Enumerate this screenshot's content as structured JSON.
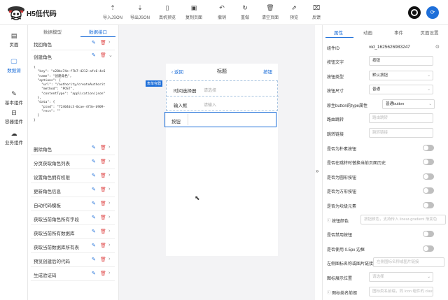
{
  "app": {
    "name": "H5低代码"
  },
  "toolbar": [
    {
      "name": "import-json-button",
      "icon": "import-icon",
      "glyph": "⇡",
      "label": "导入JSON"
    },
    {
      "name": "export-json-button",
      "icon": "export-icon",
      "glyph": "⇣",
      "label": "导出JSON"
    },
    {
      "name": "phone-preview-button",
      "icon": "phone-icon",
      "glyph": "▯",
      "label": "真机预览"
    },
    {
      "name": "copy-page-button",
      "icon": "copy-icon",
      "glyph": "▣",
      "label": "复制页面"
    },
    {
      "name": "undo-button",
      "icon": "undo-icon",
      "glyph": "↶",
      "label": "撤销"
    },
    {
      "name": "redo-button",
      "icon": "redo-icon",
      "glyph": "↻",
      "label": "重做"
    },
    {
      "name": "clear-page-button",
      "icon": "trash-icon",
      "glyph": "🗑",
      "label": "清空页面"
    },
    {
      "name": "preview-button",
      "icon": "preview-icon",
      "glyph": "⇗",
      "label": "预览"
    },
    {
      "name": "feedback-button",
      "icon": "feedback-icon",
      "glyph": "⌧",
      "label": "反馈"
    }
  ],
  "leftnav": [
    {
      "name": "nav-page",
      "icon": "page-icon",
      "glyph": "▤",
      "label": "页面"
    },
    {
      "name": "nav-data-source",
      "icon": "monitor-icon",
      "glyph": "🖵",
      "label": "数据源",
      "active": true
    },
    {
      "name": "nav-basic-components",
      "icon": "edit-icon",
      "glyph": "✎",
      "label": "基本组件"
    },
    {
      "name": "nav-container-components",
      "icon": "box-icon",
      "glyph": "⊟",
      "label": "容器组件"
    },
    {
      "name": "nav-business-components",
      "icon": "cloud-icon",
      "glyph": "☁",
      "label": "业务组件"
    }
  ],
  "datapanel": {
    "tabs": [
      "数据模型",
      "数据接口"
    ],
    "items": [
      "找回角色",
      "创建角色",
      "删除角色",
      "分页获取角色列表",
      "设置角色拥有权限",
      "更新角色信息",
      "自动代码模板",
      "获取当前角色所有字段",
      "获取当前所有数据库",
      "获取当前数据库所有表",
      "预览创建后的代码",
      "生成验证码"
    ],
    "code": "{\n  \"key\": \"e28bc74e-f7b7-4212-afc6-4c6\n  \"name\": \"创建角色\",\n  \"options\": {\n    \"url\": \"/authority/createAuthorit\n    \"method\": \"POST\",\n    \"contentType\": \"application/json\"\n  },\n  \"data\": {\n    \"pind\": \"72404dc3-0cae-4f3e-b909-\n    \"recv\": \"\"\n  }\n}"
  },
  "phone": {
    "back": "返回",
    "title": "标题",
    "button": "按钮",
    "badge": "表单容器",
    "fields": [
      {
        "label": "时间选择器",
        "placeholder": "请选择"
      },
      {
        "label": "输入框",
        "placeholder": "请输入"
      }
    ],
    "selected": "按钮"
  },
  "props": {
    "tabs": [
      "属性",
      "动画",
      "事件",
      "页面设置"
    ],
    "component_id_label": "组件ID",
    "component_id_value": "vid_1625626983247",
    "rows": [
      {
        "label": "按钮文字",
        "type": "input",
        "value": "按钮"
      },
      {
        "label": "按钮类型",
        "type": "select",
        "value": "默认按钮"
      },
      {
        "label": "按钮尺寸",
        "type": "select",
        "value": "普通"
      },
      {
        "label": "原生button的type属性",
        "type": "select",
        "value": "普通button"
      },
      {
        "label": "路由跳转",
        "type": "input",
        "placeholder": "路由跳转"
      },
      {
        "label": "跳转链接",
        "type": "input",
        "placeholder": "跳转链接"
      },
      {
        "label": "是否为朴素按钮",
        "type": "toggle"
      },
      {
        "label": "是否在跳转时替换当前页面历史",
        "type": "toggle"
      },
      {
        "label": "是否为圆形按钮",
        "type": "toggle"
      },
      {
        "label": "是否为方形按钮",
        "type": "toggle"
      },
      {
        "label": "是否为块级元素",
        "type": "toggle"
      },
      {
        "label": "按钮颜色",
        "type": "input",
        "help": true,
        "placeholder": "按钮颜色，支持传入 linear-gradient 渐变色"
      },
      {
        "label": "是否禁用按钮",
        "type": "toggle"
      },
      {
        "label": "是否使用 0.5px 边框",
        "type": "toggle"
      },
      {
        "label": "左侧图标名称或图片链接",
        "type": "input",
        "placeholder": "左侧图标名称或图片链接"
      },
      {
        "label": "图标展示位置",
        "type": "select",
        "placeholder": "请选择"
      },
      {
        "label": "图标类名前缀",
        "type": "input",
        "help": true,
        "placeholder": "图标类名前缀，同 Icon 组件的 class-pref"
      }
    ]
  }
}
